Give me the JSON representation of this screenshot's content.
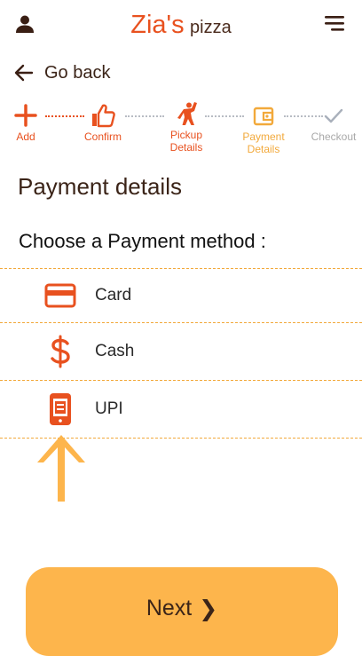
{
  "header": {
    "brand_main": "Zia's",
    "brand_sub": "pizza",
    "user_icon": "user-icon",
    "menu_icon": "menu-icon"
  },
  "nav": {
    "back_label": "Go back",
    "back_icon": "arrow-left-icon"
  },
  "stepper": {
    "steps": [
      {
        "label": "Add",
        "icon": "plus-icon",
        "state": "done"
      },
      {
        "label": "Confirm",
        "icon": "thumbs-up-icon",
        "state": "done"
      },
      {
        "label": "Pickup Details",
        "icon": "person-waving-icon",
        "state": "done"
      },
      {
        "label": "Payment Details",
        "icon": "wallet-icon",
        "state": "current"
      },
      {
        "label": "Checkout",
        "icon": "check-icon",
        "state": "pending"
      }
    ]
  },
  "page": {
    "title": "Payment details",
    "subtitle": "Choose a Payment method :"
  },
  "payment_methods": [
    {
      "label": "Card",
      "icon": "credit-card-icon"
    },
    {
      "label": "Cash",
      "icon": "dollar-icon"
    },
    {
      "label": "UPI",
      "icon": "mobile-payment-icon"
    }
  ],
  "footer": {
    "next_label": "Next",
    "next_icon": "chevron-right-icon"
  },
  "colors": {
    "accent": "#e8511f",
    "highlight": "#f2a93b",
    "button": "#fdb54c",
    "text": "#3b2418",
    "pending": "#a9a9a9"
  }
}
